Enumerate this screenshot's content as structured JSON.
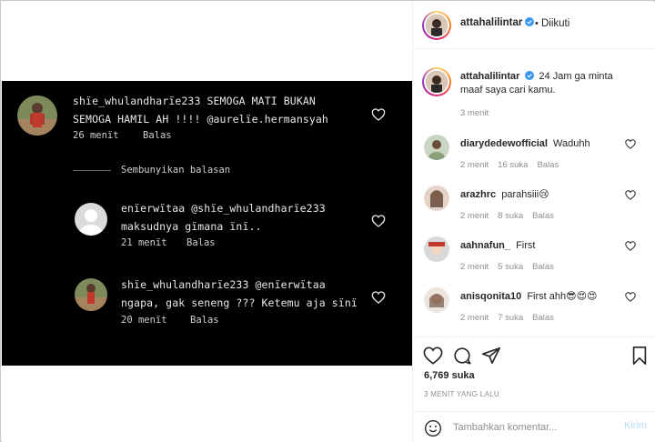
{
  "post": {
    "author": "attahalilintar",
    "follow_separator": "•",
    "follow_status": "Diikuti",
    "caption": {
      "username": "attahalilintar",
      "text": "24 Jam ga minta maaf saya cari kamu.",
      "time": "3 menit"
    },
    "likes": "6,769 suka",
    "time_ago": "3 MENIT YANG LALU",
    "add_comment_placeholder": "Tambahkan komentar...",
    "post_label": "Kirim"
  },
  "screenshot": {
    "comment1": {
      "line1": "shïe_whulandharïe233 SEMOGA MATI BUKAN",
      "line2": "SEMOGA HAMIL AH !!!! @aurelïe.hermansyah",
      "time": "26 menït",
      "reply": "Balas"
    },
    "hide_replies": "Sembunyikan balasan",
    "reply1": {
      "line1": "enïerwïtaa @shïe_whulandharïe233",
      "line2": "maksudnya gïmana ïnï..",
      "time": "21 menït",
      "reply": "Balas"
    },
    "reply2": {
      "line1": "shïe_whulandharïe233 @enïerwïtaa",
      "line2": "ngapa, gak seneng ??? Ketemu aja sïnï",
      "time": "20 menït",
      "reply": "Balas"
    }
  },
  "comments": [
    {
      "username": "diarydedewofficial",
      "text": "Waduhh",
      "time": "2 menit",
      "likes": "16 suka",
      "reply": "Balas"
    },
    {
      "username": "arazhrc",
      "text": "parahsiii😢",
      "time": "2 menit",
      "likes": "8 suka",
      "reply": "Balas"
    },
    {
      "username": "aahnafun_",
      "text": "First",
      "time": "2 menit",
      "likes": "5 suka",
      "reply": "Balas"
    },
    {
      "username": "anisqonita10",
      "text": "First ahh😎😍😍",
      "time": "2 menit",
      "likes": "7 suka",
      "reply": "Balas"
    }
  ],
  "icons": {
    "verified": "verified-badge-icon",
    "like": "heart-icon",
    "comment": "comment-bubble-icon",
    "share": "paper-plane-icon",
    "save": "bookmark-icon",
    "emoji": "emoji-smile-icon"
  },
  "colors": {
    "verified_blue": "#3897f0",
    "post_button_disabled": "#b2dffc",
    "secondary_text": "#8e8e8e"
  }
}
